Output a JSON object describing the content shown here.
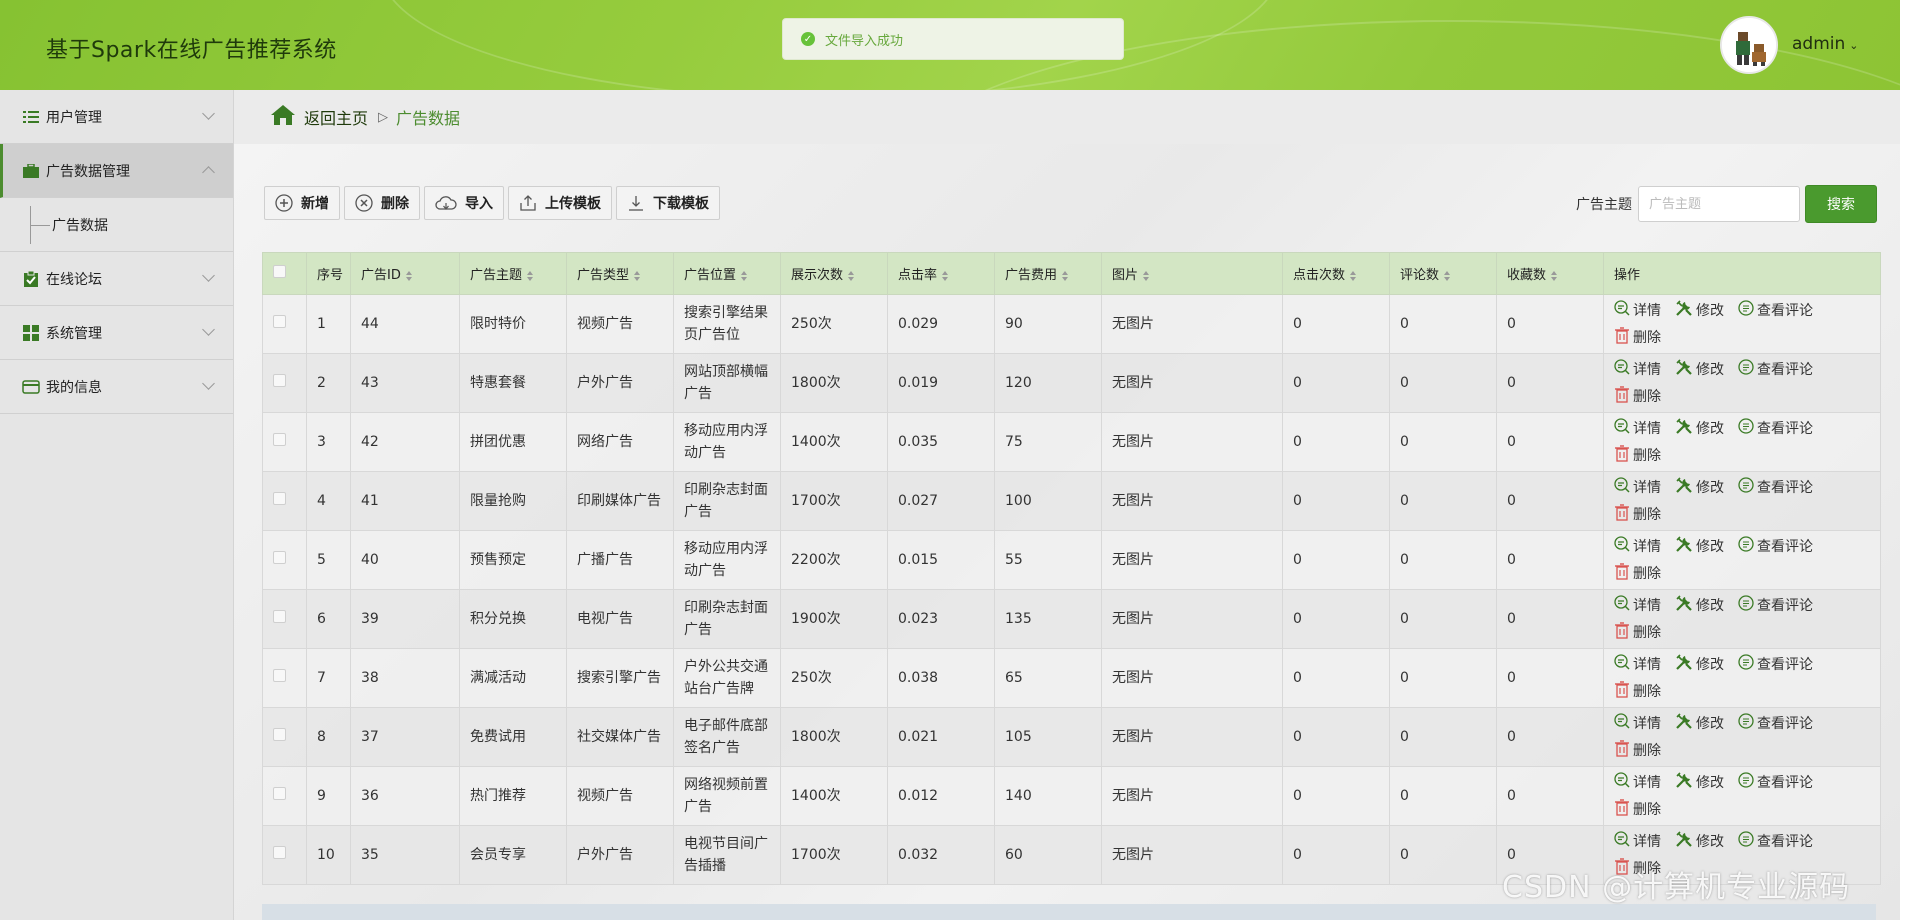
{
  "app": {
    "title": "基于Spark在线广告推荐系统",
    "toast": "文件导入成功",
    "user": "admin"
  },
  "sidebar": {
    "items": [
      {
        "label": "用户管理",
        "icon": "list-icon"
      },
      {
        "label": "广告数据管理",
        "icon": "briefcase-icon"
      },
      {
        "label": "在线论坛",
        "icon": "clipboard-check-icon"
      },
      {
        "label": "系统管理",
        "icon": "grid-icon"
      },
      {
        "label": "我的信息",
        "icon": "card-icon"
      }
    ],
    "sub": {
      "label": "广告数据"
    }
  },
  "breadcrumb": {
    "home": "返回主页",
    "sep": "▷",
    "current": "广告数据"
  },
  "toolbar": {
    "add": "新增",
    "delete": "删除",
    "import": "导入",
    "upload": "上传模板",
    "download": "下载模板"
  },
  "search": {
    "label": "广告主题",
    "placeholder": "广告主题",
    "button": "搜索"
  },
  "table": {
    "headers": [
      "序号",
      "广告ID",
      "广告主题",
      "广告类型",
      "广告位置",
      "展示次数",
      "点击率",
      "广告费用",
      "图片",
      "点击次数",
      "评论数",
      "收藏数",
      "操作"
    ],
    "rows": [
      [
        "1",
        "44",
        "限时特价",
        "视频广告",
        "搜索引擎结果页广告位",
        "250次",
        "0.029",
        "90",
        "无图片",
        "0",
        "0",
        "0"
      ],
      [
        "2",
        "43",
        "特惠套餐",
        "户外广告",
        "网站顶部横幅广告",
        "1800次",
        "0.019",
        "120",
        "无图片",
        "0",
        "0",
        "0"
      ],
      [
        "3",
        "42",
        "拼团优惠",
        "网络广告",
        "移动应用内浮动广告",
        "1400次",
        "0.035",
        "75",
        "无图片",
        "0",
        "0",
        "0"
      ],
      [
        "4",
        "41",
        "限量抢购",
        "印刷媒体广告",
        "印刷杂志封面广告",
        "1700次",
        "0.027",
        "100",
        "无图片",
        "0",
        "0",
        "0"
      ],
      [
        "5",
        "40",
        "预售预定",
        "广播广告",
        "移动应用内浮动广告",
        "2200次",
        "0.015",
        "55",
        "无图片",
        "0",
        "0",
        "0"
      ],
      [
        "6",
        "39",
        "积分兑换",
        "电视广告",
        "印刷杂志封面广告",
        "1900次",
        "0.023",
        "135",
        "无图片",
        "0",
        "0",
        "0"
      ],
      [
        "7",
        "38",
        "满减活动",
        "搜索引擎广告",
        "户外公共交通站台广告牌",
        "250次",
        "0.038",
        "65",
        "无图片",
        "0",
        "0",
        "0"
      ],
      [
        "8",
        "37",
        "免费试用",
        "社交媒体广告",
        "电子邮件底部签名广告",
        "1800次",
        "0.021",
        "105",
        "无图片",
        "0",
        "0",
        "0"
      ],
      [
        "9",
        "36",
        "热门推荐",
        "视频广告",
        "网络视频前置广告",
        "1400次",
        "0.012",
        "140",
        "无图片",
        "0",
        "0",
        "0"
      ],
      [
        "10",
        "35",
        "会员专享",
        "户外广告",
        "电视节目间广告插播",
        "1700次",
        "0.032",
        "60",
        "无图片",
        "0",
        "0",
        "0"
      ]
    ],
    "actions": {
      "detail": "详情",
      "edit": "修改",
      "comments": "查看评论",
      "delete": "删除"
    }
  },
  "watermark": "CSDN @计算机专业源码",
  "colors": {
    "accent": "#4a9a2e",
    "header": "#96cc3d",
    "table_header": "#d3e6c4"
  }
}
